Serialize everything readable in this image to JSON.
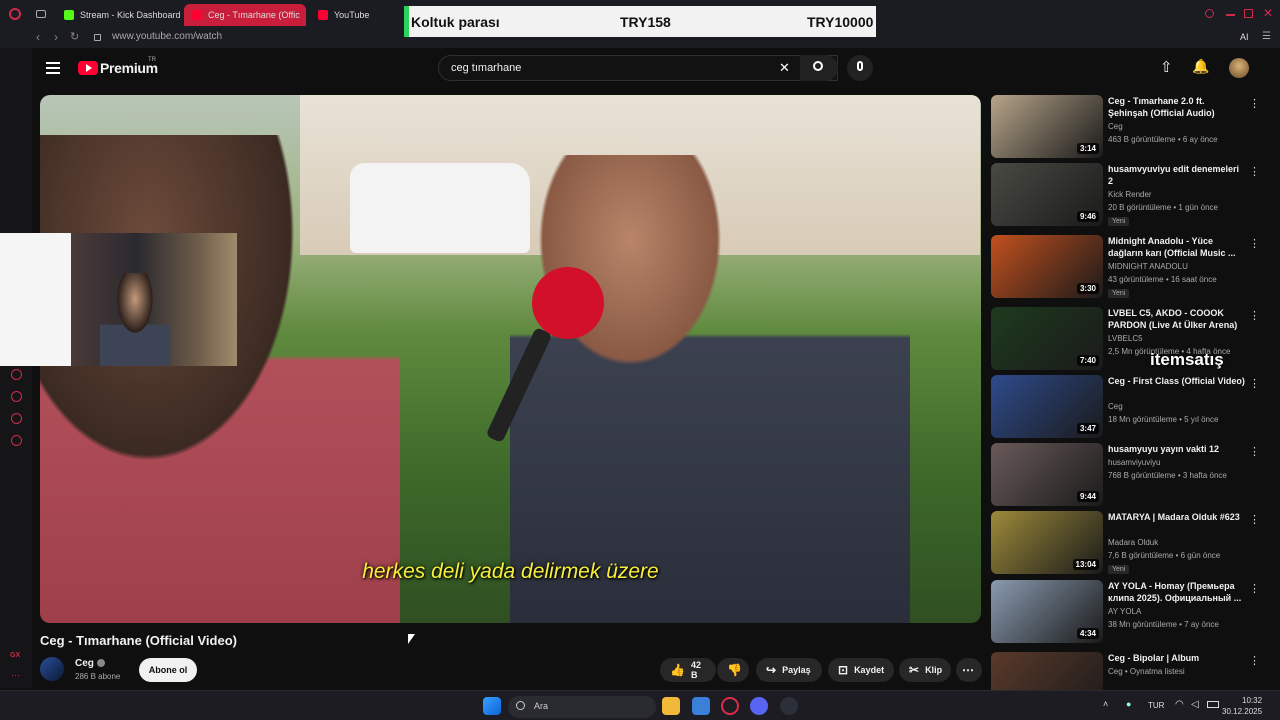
{
  "browser": {
    "tabs": [
      {
        "label": "Stream - Kick Dashboard",
        "color": "#53fc18"
      },
      {
        "label": "Ceg - Tımarhane (Offic",
        "color": "#ff0033"
      },
      {
        "label": "YouTube",
        "color": "#ff0033"
      }
    ],
    "url": "www.youtube.com/watch",
    "sidebar_badge": "GX",
    "ai_label": "AI"
  },
  "overlay": {
    "label": "Koltuk parası",
    "current": "TRY158",
    "goal": "TRY10000"
  },
  "youtube": {
    "logo_text": "Premium",
    "logo_region": "TR",
    "search_value": "ceg tımarhane",
    "accent": "#ff0033"
  },
  "video": {
    "subtitle": "herkes deli yada delirmek üzere",
    "title": "Ceg - Tımarhane (Official Video)",
    "channel": "Ceg",
    "subscribers": "286 B abone",
    "subscribe_label": "Abone ol",
    "likes": "42 B",
    "share_label": "Paylaş",
    "save_label": "Kaydet",
    "clip_label": "Klip"
  },
  "watermark": "itemsatış",
  "related": [
    {
      "title": "Ceg - Tımarhane 2.0 ft. Şehinşah (Official Audio)",
      "channel": "Ceg",
      "meta": "463 B görüntüleme • 6 ay önce",
      "duration": "3:14",
      "badge": "",
      "thumb": "#b7a58a"
    },
    {
      "title": "husamvyuviyu edit denemeleri 2",
      "channel": "Kick Render",
      "meta": "20 B görüntüleme • 1 gün önce",
      "duration": "9:46",
      "badge": "Yeni",
      "thumb": "#4a4a44"
    },
    {
      "title": "Midnight Anadolu - Yüce dağların karı (Official Music ...",
      "channel": "MIDNIGHT ANADOLU",
      "meta": "43 görüntüleme • 16 saat önce",
      "duration": "3:30",
      "badge": "Yeni",
      "thumb": "#c2501e"
    },
    {
      "title": "LVBEL C5, AKDO - COOOK PARDON (Live At Ülker Arena)",
      "channel": "LVBELC5",
      "meta": "2,5 Mn görüntüleme • 4 hafta önce",
      "duration": "7:40",
      "badge": "",
      "thumb": "#1e3a1e"
    },
    {
      "title": "Ceg - First Class (Official Video)",
      "channel": "Ceg",
      "meta": "18 Mn görüntüleme • 5 yıl önce",
      "duration": "3:47",
      "badge": "",
      "thumb": "#2e4b8c"
    },
    {
      "title": "husamyuyu yayın vakti 12",
      "channel": "husamviyuviyu",
      "meta": "768 B görüntüleme • 3 hafta önce",
      "duration": "9:44",
      "badge": "",
      "thumb": "#6a5a5a"
    },
    {
      "title": "MATARYA | Madara Olduk #623",
      "channel": "Madara Olduk",
      "meta": "7,6 B görüntüleme • 6 gün önce",
      "duration": "13:04",
      "badge": "Yeni",
      "thumb": "#9c8a3a"
    },
    {
      "title": "AY YOLA - Homay (Премьера клипа 2025). Официальный ...",
      "channel": "AY YOLA",
      "meta": "38 Mn görüntüleme • 7 ay önce",
      "duration": "4:34",
      "badge": "",
      "thumb": "#8a9bb0"
    },
    {
      "title": "Ceg - Bipolar | Album",
      "channel": "Ceg • Oynatma listesi",
      "meta": "",
      "duration": "",
      "badge": "",
      "thumb": "#5a3a2a"
    }
  ],
  "taskbar": {
    "search_placeholder": "Ara",
    "lang": "TUR",
    "time": "10:32",
    "date": "30.12.2025"
  }
}
